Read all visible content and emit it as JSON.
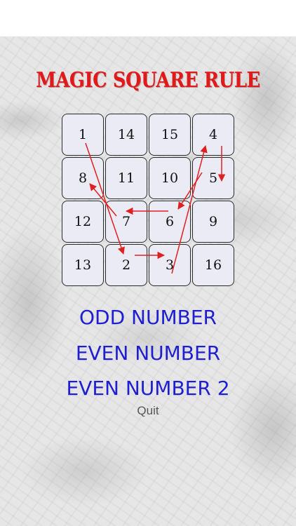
{
  "title": "MAGIC SQUARE RULE",
  "grid": {
    "rows": [
      [
        "1",
        "14",
        "15",
        "4"
      ],
      [
        "8",
        "11",
        "10",
        "5"
      ],
      [
        "12",
        "7",
        "6",
        "9"
      ],
      [
        "13",
        "2",
        "3",
        "16"
      ]
    ]
  },
  "arrow_color": "#e02020",
  "menu": {
    "odd_label": "ODD NUMBER",
    "even_label": "EVEN NUMBER",
    "even2_label": "EVEN NUMBER 2",
    "quit_label": "Quit"
  },
  "colors": {
    "title": "#e01a1a",
    "menu": "#1f1fd1",
    "cell_background": "#ebebf6"
  }
}
